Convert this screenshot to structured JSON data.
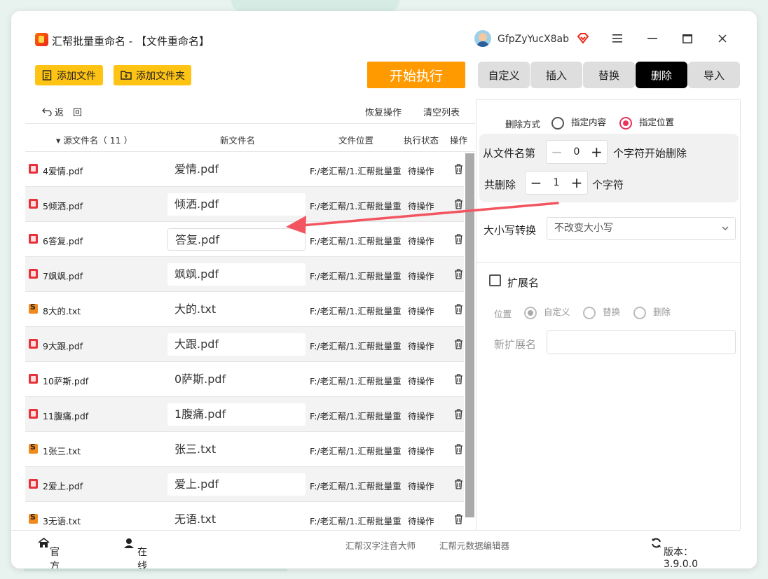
{
  "app": {
    "title": "汇帮批量重命名 - 【文件重命名】",
    "username": "GfpZyYucX8ab"
  },
  "toolbar": {
    "add_files": "添加文件",
    "add_folder": "添加文件夹",
    "start": "开始执行"
  },
  "tabs": [
    {
      "label": "自定义",
      "active": false
    },
    {
      "label": "插入",
      "active": false
    },
    {
      "label": "替换",
      "active": false
    },
    {
      "label": "删除",
      "active": true
    },
    {
      "label": "导入",
      "active": false
    }
  ],
  "subbar": {
    "back": "返　回",
    "restore": "恢复操作",
    "clear": "清空列表"
  },
  "table": {
    "headers": {
      "source": "▾ 源文件名（ 11 ）",
      "new_name": "新文件名",
      "location": "文件位置",
      "status": "执行状态",
      "action": "操作"
    },
    "rows": [
      {
        "type": "pdf",
        "original": "4爱情.pdf",
        "new": "爱情.pdf",
        "location": "F:/老汇帮/1.汇帮批量重命名",
        "status": "待操作"
      },
      {
        "type": "pdf",
        "original": "5倾洒.pdf",
        "new": "倾洒.pdf",
        "location": "F:/老汇帮/1.汇帮批量重命名",
        "status": "待操作"
      },
      {
        "type": "pdf",
        "original": "6答复.pdf",
        "new": "答复.pdf",
        "location": "F:/老汇帮/1.汇帮批量重命名",
        "status": "待操作"
      },
      {
        "type": "pdf",
        "original": "7飒飒.pdf",
        "new": "飒飒.pdf",
        "location": "F:/老汇帮/1.汇帮批量重命名",
        "status": "待操作"
      },
      {
        "type": "txt",
        "original": "8大的.txt",
        "new": "大的.txt",
        "location": "F:/老汇帮/1.汇帮批量重命名",
        "status": "待操作"
      },
      {
        "type": "pdf",
        "original": "9大跟.pdf",
        "new": "大跟.pdf",
        "location": "F:/老汇帮/1.汇帮批量重命名",
        "status": "待操作"
      },
      {
        "type": "pdf",
        "original": "10萨斯.pdf",
        "new": "0萨斯.pdf",
        "location": "F:/老汇帮/1.汇帮批量重命名",
        "status": "待操作"
      },
      {
        "type": "pdf",
        "original": "11腹痛.pdf",
        "new": "1腹痛.pdf",
        "location": "F:/老汇帮/1.汇帮批量重命名",
        "status": "待操作"
      },
      {
        "type": "txt",
        "original": "1张三.txt",
        "new": "张三.txt",
        "location": "F:/老汇帮/1.汇帮批量重命名",
        "status": "待操作"
      },
      {
        "type": "pdf",
        "original": "2爱上.pdf",
        "new": "爱上.pdf",
        "location": "F:/老汇帮/1.汇帮批量重命名",
        "status": "待操作"
      },
      {
        "type": "txt",
        "original": "3无语.txt",
        "new": "无语.txt",
        "location": "F:/老汇帮/1.汇帮批量重命名",
        "status": "待操作"
      }
    ]
  },
  "panel": {
    "delete_mode_label": "删除方式",
    "mode_content": "指定内容",
    "mode_position": "指定位置",
    "from_label": "从文件名第",
    "from_value": "0",
    "from_suffix": "个字符开始删除",
    "count_label": "共删除",
    "count_value": "1",
    "count_suffix": "个字符",
    "case_label": "大小写转换",
    "case_value": "不改变大小写",
    "ext_label": "扩展名",
    "position_label": "位置",
    "pos_custom": "自定义",
    "pos_replace": "替换",
    "pos_delete": "删除",
    "new_ext_label": "新扩展名",
    "new_ext_value": ""
  },
  "footer": {
    "website": "官方网站",
    "support": "在线客服",
    "link1": "汇帮汉字注音大师",
    "link2": "汇帮元数据编辑器",
    "version": "版本：3.9.0.0"
  },
  "colors": {
    "accent_yellow": "#ffc313",
    "start_orange": "#ff9a00",
    "radio_red": "#e8335c",
    "annotation_arrow": "#f25560"
  }
}
